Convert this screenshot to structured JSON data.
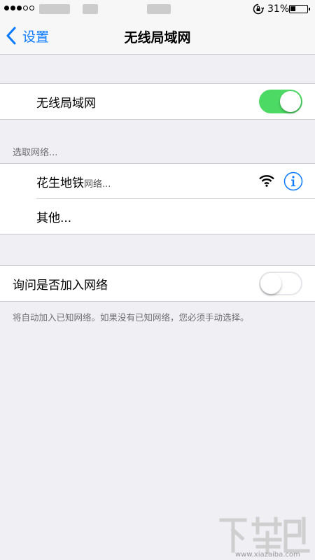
{
  "status_bar": {
    "signal_dots_filled": 3,
    "signal_dots_total": 5,
    "orientation_lock_icon": "orientation-lock-icon",
    "battery_percent": "31%",
    "battery_level": 0.31
  },
  "nav": {
    "back_icon": "chevron-left-icon",
    "back_label": "设置",
    "title": "无线局域网"
  },
  "wifi_toggle": {
    "label": "无线局域网",
    "on": true
  },
  "networks": {
    "section_header": "选取网络...",
    "items": [
      {
        "name": "花生地铁",
        "name_suffix": "网络...",
        "icons": [
          "wifi-signal-icon",
          "info-icon"
        ]
      },
      {
        "name": "其他..."
      }
    ]
  },
  "ask_to_join": {
    "label": "询问是否加入网络",
    "on": false,
    "footer": "将自动加入已知网络。如果没有已知网络，您必须手动选择。"
  },
  "colors": {
    "accent": "#0a7aff",
    "toggle_on": "#4cd964",
    "background": "#efeff4"
  },
  "watermark": {
    "text": "下载吧",
    "url": "www.xiazaiba.com"
  }
}
